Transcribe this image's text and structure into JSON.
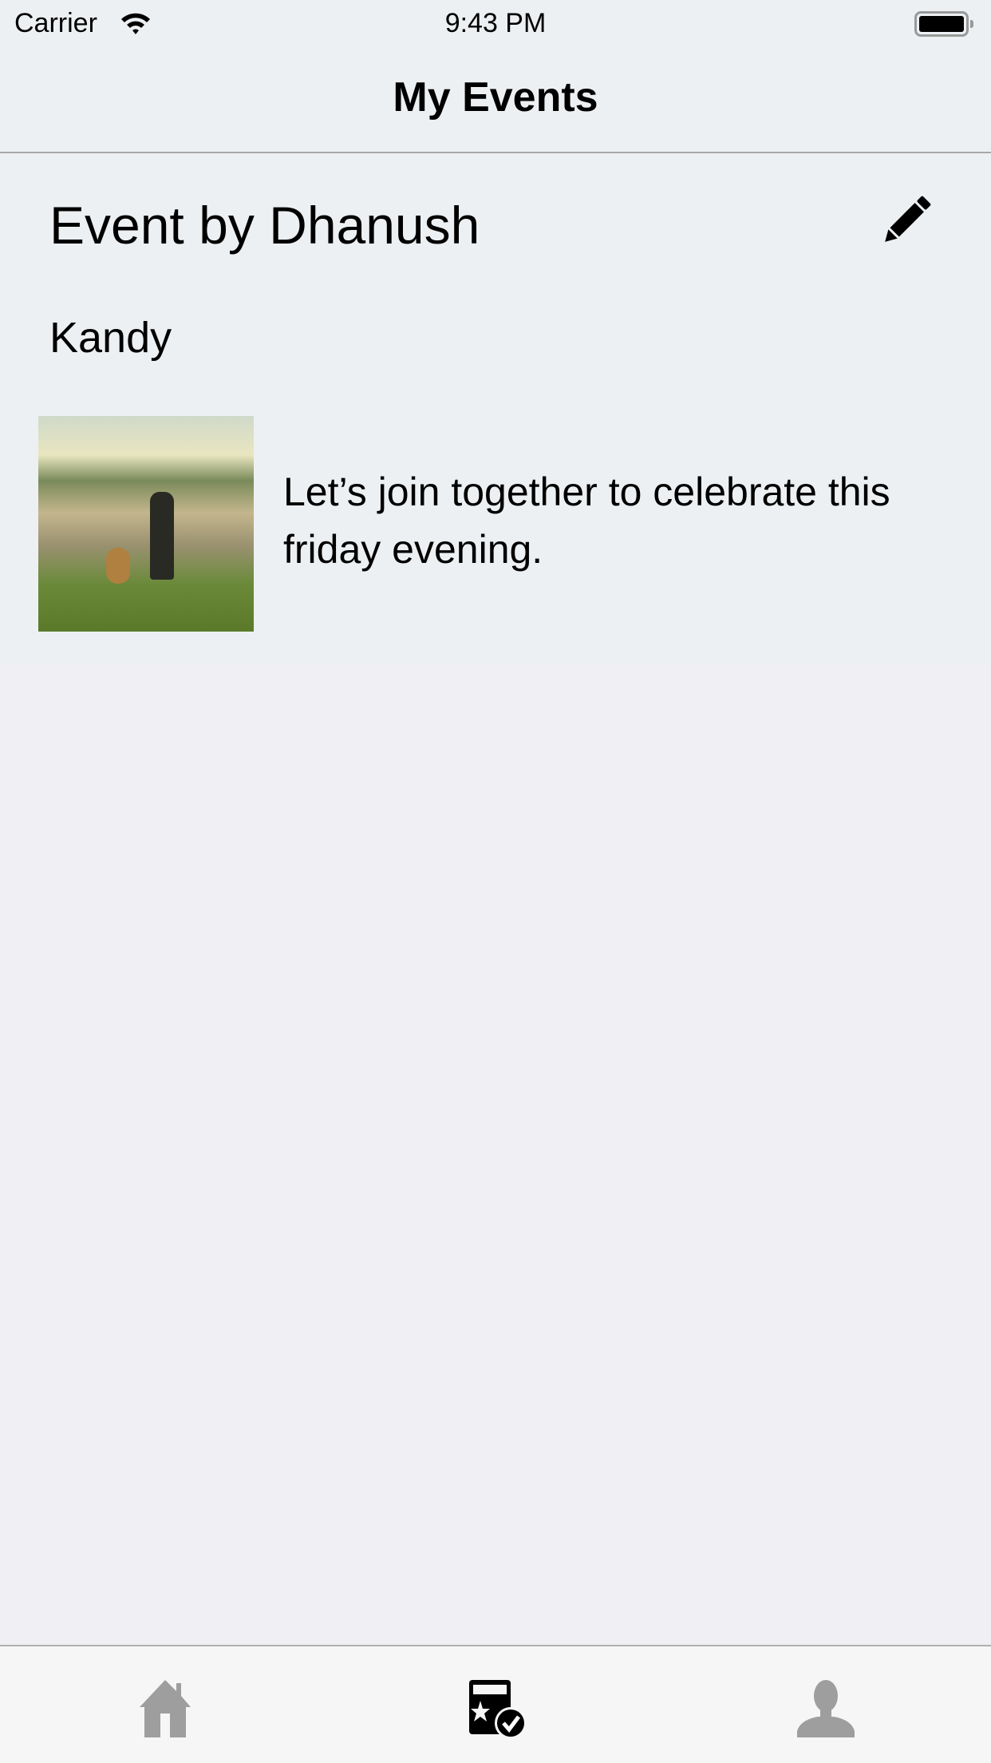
{
  "status_bar": {
    "carrier": "Carrier",
    "time": "9:43 PM",
    "wifi_icon": "wifi-icon",
    "battery_icon": "battery-icon"
  },
  "nav": {
    "title": "My Events"
  },
  "event": {
    "title": "Event by Dhanush",
    "location": "Kandy",
    "description": "Let’s join together to celebrate this friday evening.",
    "edit_icon": "pencil-icon"
  },
  "tab_bar": {
    "items": [
      {
        "icon": "home-icon",
        "active": false
      },
      {
        "icon": "my-events-icon",
        "active": true
      },
      {
        "icon": "profile-icon",
        "active": false
      }
    ],
    "active_color": "#000000",
    "inactive_color": "#9e9e9e"
  }
}
